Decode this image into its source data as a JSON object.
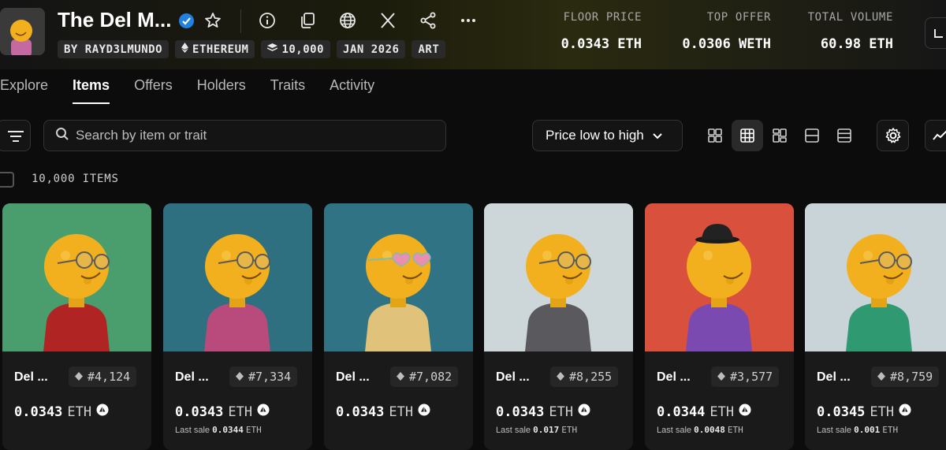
{
  "collection": {
    "title": "The Del M...",
    "chips": {
      "creator": "BY RAYD3LMUNDO",
      "chain": "ETHEREUM",
      "supply": "10,000",
      "date": "JAN 2026",
      "category": "ART"
    },
    "stats": [
      {
        "label": "FLOOR PRICE",
        "value": "0.0343 ETH"
      },
      {
        "label": "TOP OFFER",
        "value": "0.0306 WETH"
      },
      {
        "label": "TOTAL VOLUME",
        "value": "60.98 ETH"
      }
    ]
  },
  "tabs": [
    "Explore",
    "Items",
    "Offers",
    "Holders",
    "Traits",
    "Activity"
  ],
  "active_tab": "Items",
  "toolbar": {
    "search_placeholder": "Search by item or trait",
    "sort_label": "Price low to high"
  },
  "items_count": "10,000 ITEMS",
  "cards": [
    {
      "name": "Del ...",
      "token": "#4,124",
      "price": "0.0343",
      "unit": "ETH",
      "last_sale_label": "",
      "last_sale_value": "",
      "last_sale_unit": "",
      "bg": "#4a9e6e",
      "shirt": "#b02424"
    },
    {
      "name": "Del ...",
      "token": "#7,334",
      "price": "0.0343",
      "unit": "ETH",
      "last_sale_label": "Last sale",
      "last_sale_value": "0.0344",
      "last_sale_unit": "ETH",
      "bg": "#2e6f80",
      "shirt": "#b84a7c"
    },
    {
      "name": "Del ...",
      "token": "#7,082",
      "price": "0.0343",
      "unit": "ETH",
      "last_sale_label": "",
      "last_sale_value": "",
      "last_sale_unit": "",
      "bg": "#2f7384",
      "shirt": "#e0c27a"
    },
    {
      "name": "Del ...",
      "token": "#8,255",
      "price": "0.0343",
      "unit": "ETH",
      "last_sale_label": "Last sale",
      "last_sale_value": "0.017",
      "last_sale_unit": "ETH",
      "bg": "#cdd7da",
      "shirt": "#5a5a5e"
    },
    {
      "name": "Del ...",
      "token": "#3,577",
      "price": "0.0344",
      "unit": "ETH",
      "last_sale_label": "Last sale",
      "last_sale_value": "0.0048",
      "last_sale_unit": "ETH",
      "bg": "#d9503c",
      "shirt": "#7a4ab0"
    },
    {
      "name": "Del ...",
      "token": "#8,759",
      "price": "0.0345",
      "unit": "ETH",
      "last_sale_label": "Last sale",
      "last_sale_value": "0.001",
      "last_sale_unit": "ETH",
      "bg": "#c9d4d8",
      "shirt": "#2f9a72"
    }
  ]
}
